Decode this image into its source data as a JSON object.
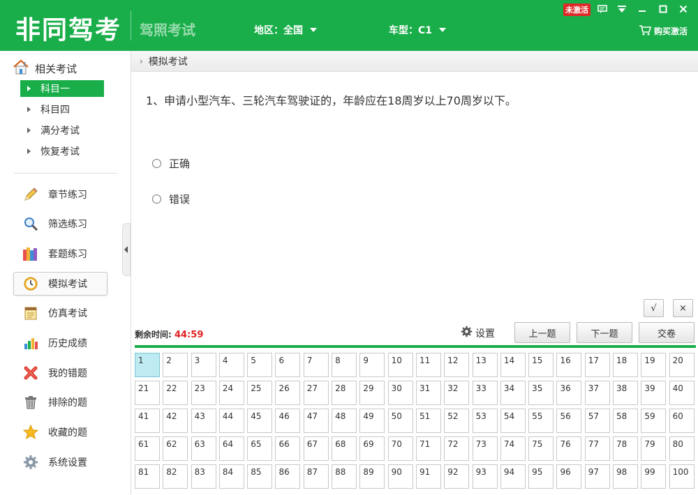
{
  "header": {
    "brand": "非同驾考",
    "subtitle": "驾照考试",
    "region_label": "地区：全国",
    "cartype_label": "车型：C1",
    "badge": "未激活",
    "buy_label": "购买激活",
    "brand_color": "#1aae4a"
  },
  "sidebar": {
    "group_title": "相关考试",
    "sub_items": [
      "科目一",
      "科目四",
      "满分考试",
      "恢复考试"
    ],
    "active_sub": "科目一",
    "nav_items": [
      {
        "label": "章节练习",
        "icon": "pencil-icon"
      },
      {
        "label": "筛选练习",
        "icon": "magnifier-icon"
      },
      {
        "label": "套题练习",
        "icon": "books-icon"
      },
      {
        "label": "模拟考试",
        "icon": "clock-icon"
      },
      {
        "label": "仿真考试",
        "icon": "notepad-icon"
      },
      {
        "label": "历史成绩",
        "icon": "bar-chart-icon"
      },
      {
        "label": "我的错题",
        "icon": "red-x-icon"
      },
      {
        "label": "排除的题",
        "icon": "trash-icon"
      },
      {
        "label": "收藏的题",
        "icon": "star-icon"
      },
      {
        "label": "系统设置",
        "icon": "gear-icon"
      }
    ],
    "active_nav": "模拟考试"
  },
  "main": {
    "breadcrumb": "模拟考试",
    "question": "1、申请小型汽车、三轮汽车驾驶证的，年龄应在18周岁以上70周岁以下。",
    "options": [
      "正确",
      "错误"
    ],
    "correct_btn": "√",
    "wrong_btn": "×",
    "timer_label": "剩余时间:",
    "timer_value": "44:59",
    "settings_label": "设置",
    "prev_label": "上一题",
    "next_label": "下一题",
    "submit_label": "交卷",
    "question_count": 100,
    "current_question": 1
  }
}
